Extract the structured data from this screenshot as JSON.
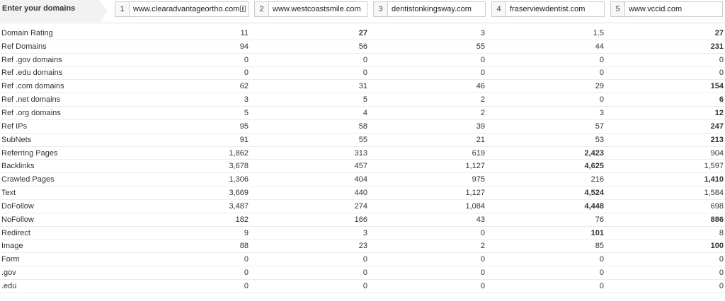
{
  "header": {
    "label": "Enter your domains",
    "domains": [
      {
        "num": "1",
        "value": "www.clearadvantageortho.com"
      },
      {
        "num": "2",
        "value": "www.westcoastsmile.com"
      },
      {
        "num": "3",
        "value": "dentistonkingsway.com"
      },
      {
        "num": "4",
        "value": "fraserviewdentist.com"
      },
      {
        "num": "5",
        "value": "www.vccid.com"
      }
    ]
  },
  "rows": [
    {
      "label": "Domain Rating",
      "values": [
        "11",
        "27",
        "3",
        "1.5",
        "27"
      ],
      "bold": [
        false,
        true,
        false,
        false,
        true
      ]
    },
    {
      "label": "Ref Domains",
      "values": [
        "94",
        "56",
        "55",
        "44",
        "231"
      ],
      "bold": [
        false,
        false,
        false,
        false,
        true
      ]
    },
    {
      "label": "Ref .gov domains",
      "values": [
        "0",
        "0",
        "0",
        "0",
        "0"
      ],
      "bold": [
        false,
        false,
        false,
        false,
        false
      ]
    },
    {
      "label": "Ref .edu domains",
      "values": [
        "0",
        "0",
        "0",
        "0",
        "0"
      ],
      "bold": [
        false,
        false,
        false,
        false,
        false
      ]
    },
    {
      "label": "Ref .com domains",
      "values": [
        "62",
        "31",
        "46",
        "29",
        "154"
      ],
      "bold": [
        false,
        false,
        false,
        false,
        true
      ]
    },
    {
      "label": "Ref .net domains",
      "values": [
        "3",
        "5",
        "2",
        "0",
        "6"
      ],
      "bold": [
        false,
        false,
        false,
        false,
        true
      ]
    },
    {
      "label": "Ref .org domains",
      "values": [
        "5",
        "4",
        "2",
        "3",
        "12"
      ],
      "bold": [
        false,
        false,
        false,
        false,
        true
      ]
    },
    {
      "label": "Ref IPs",
      "values": [
        "95",
        "58",
        "39",
        "57",
        "247"
      ],
      "bold": [
        false,
        false,
        false,
        false,
        true
      ]
    },
    {
      "label": "SubNets",
      "values": [
        "91",
        "55",
        "21",
        "53",
        "213"
      ],
      "bold": [
        false,
        false,
        false,
        false,
        true
      ]
    },
    {
      "label": "Referring Pages",
      "values": [
        "1,862",
        "313",
        "619",
        "2,423",
        "904"
      ],
      "bold": [
        false,
        false,
        false,
        true,
        false
      ]
    },
    {
      "label": "Backlinks",
      "values": [
        "3,678",
        "457",
        "1,127",
        "4,625",
        "1,597"
      ],
      "bold": [
        false,
        false,
        false,
        true,
        false
      ]
    },
    {
      "label": "Crawled Pages",
      "values": [
        "1,306",
        "404",
        "975",
        "216",
        "1,410"
      ],
      "bold": [
        false,
        false,
        false,
        false,
        true
      ]
    },
    {
      "label": "Text",
      "values": [
        "3,669",
        "440",
        "1,127",
        "4,524",
        "1,584"
      ],
      "bold": [
        false,
        false,
        false,
        true,
        false
      ]
    },
    {
      "label": "DoFollow",
      "values": [
        "3,487",
        "274",
        "1,084",
        "4,448",
        "698"
      ],
      "bold": [
        false,
        false,
        false,
        true,
        false
      ]
    },
    {
      "label": "NoFollow",
      "values": [
        "182",
        "166",
        "43",
        "76",
        "886"
      ],
      "bold": [
        false,
        false,
        false,
        false,
        true
      ]
    },
    {
      "label": "Redirect",
      "values": [
        "9",
        "3",
        "0",
        "101",
        "8"
      ],
      "bold": [
        false,
        false,
        false,
        true,
        false
      ]
    },
    {
      "label": "Image",
      "values": [
        "88",
        "23",
        "2",
        "85",
        "100"
      ],
      "bold": [
        false,
        false,
        false,
        false,
        true
      ]
    },
    {
      "label": "Form",
      "values": [
        "0",
        "0",
        "0",
        "0",
        "0"
      ],
      "bold": [
        false,
        false,
        false,
        false,
        false
      ]
    },
    {
      "label": ".gov",
      "values": [
        "0",
        "0",
        "0",
        "0",
        "0"
      ],
      "bold": [
        false,
        false,
        false,
        false,
        false
      ]
    },
    {
      "label": ".edu",
      "values": [
        "0",
        "0",
        "0",
        "0",
        "0"
      ],
      "bold": [
        false,
        false,
        false,
        false,
        false
      ]
    }
  ]
}
